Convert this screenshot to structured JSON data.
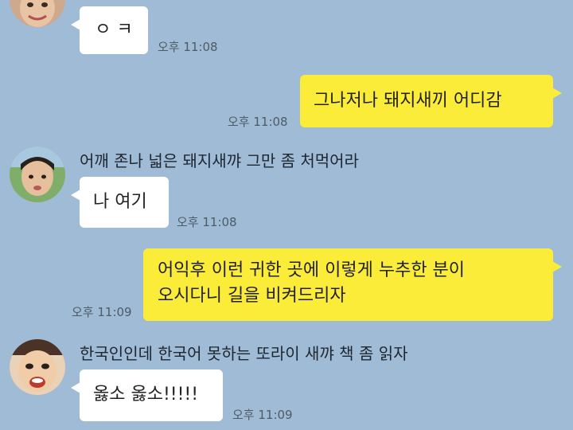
{
  "messages": [
    {
      "text": "ㅇ ㅋ",
      "time": "오후 11:08"
    },
    {
      "text": "그나저나 돼지새끼 어디감",
      "time": "오후 11:08"
    },
    {
      "sender": "어깨 존나 넓은 돼지새꺄 그만 좀 처먹어라",
      "text": "나 여기",
      "time": "오후 11:08"
    },
    {
      "lines": [
        "어익후 이런 귀한 곳에 이렇게 누추한 분이",
        "오시다니 길을 비켜드리자"
      ],
      "time": "오후 11:09"
    },
    {
      "sender": "한국인인데 한국어 못하는 또라이 새꺄 책 좀 읽자",
      "text": "옳소 옳소!!!!!",
      "time": "오후 11:09"
    }
  ],
  "colors": {
    "background": "#9fbbd6",
    "incoming_bubble": "#ffffff",
    "outgoing_bubble": "#fbec3a"
  },
  "icons": [
    "avatar-photo",
    "avatar-photo",
    "avatar-photo"
  ]
}
